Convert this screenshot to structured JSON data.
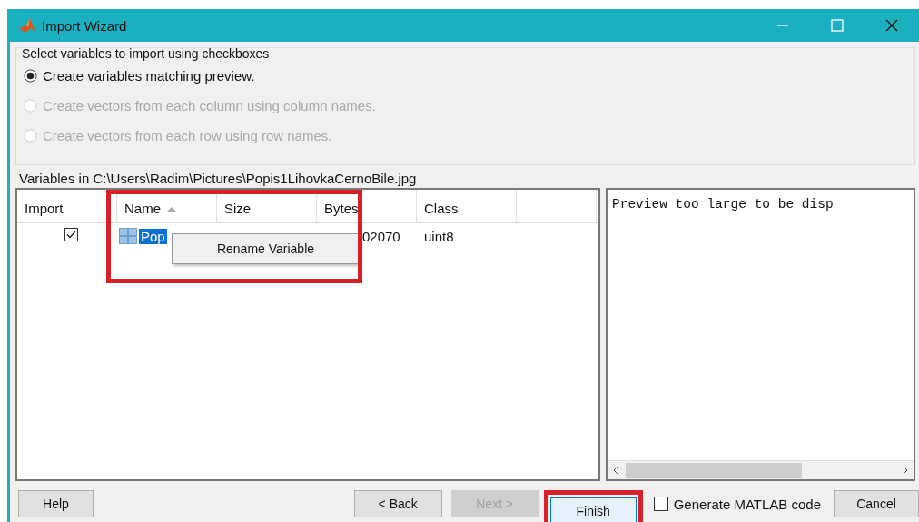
{
  "window": {
    "title": "Import Wizard"
  },
  "options": {
    "title": "Select variables to import using checkboxes",
    "radios": [
      {
        "label": "Create variables matching preview.",
        "selected": true,
        "disabled": false
      },
      {
        "label": "Create vectors from each column using column names.",
        "selected": false,
        "disabled": true
      },
      {
        "label": "Create vectors from each row using row names.",
        "selected": false,
        "disabled": true
      }
    ]
  },
  "variables_label": "Variables in C:\\Users\\Radim\\Pictures\\Popis1LihovkaCernoBile.jpg",
  "table": {
    "columns": [
      {
        "label": "Import",
        "sorted": false
      },
      {
        "label": "Name",
        "sorted": true
      },
      {
        "label": "Size",
        "sorted": false
      },
      {
        "label": "Bytes",
        "sorted": false
      },
      {
        "label": "Class",
        "sorted": false
      }
    ],
    "rows": [
      {
        "checked": true,
        "name": "Pop",
        "bytes": "02070",
        "class": "uint8",
        "selected": true
      }
    ]
  },
  "context_menu": {
    "items": [
      "Rename Variable"
    ]
  },
  "preview": {
    "text": "Preview too large to be disp"
  },
  "footer": {
    "buttons": [
      {
        "label": "Help",
        "disabled": false,
        "focused": false
      },
      {
        "label": "< Back",
        "disabled": false,
        "focused": false
      },
      {
        "label": "Next >",
        "disabled": true,
        "focused": false
      },
      {
        "label": "Finish",
        "disabled": false,
        "focused": true
      }
    ],
    "generate_code": {
      "label": "Generate MATLAB code",
      "checked": false
    },
    "cancel": {
      "label": "Cancel",
      "disabled": false
    }
  }
}
